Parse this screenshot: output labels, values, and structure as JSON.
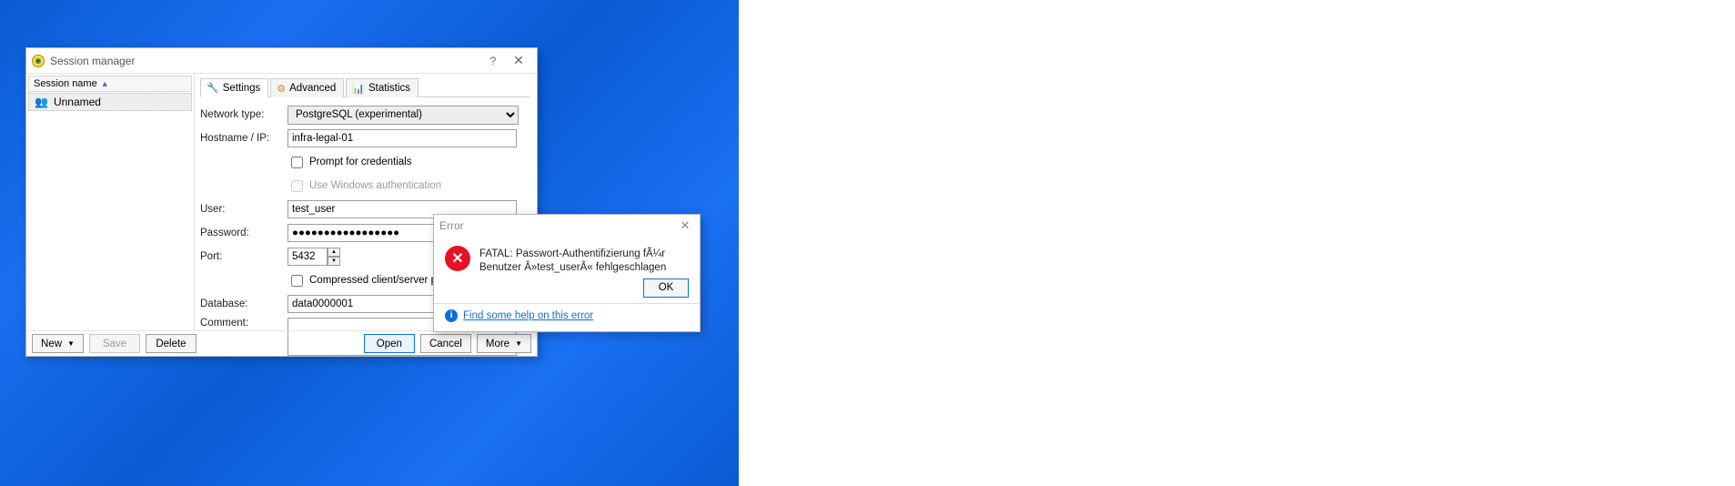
{
  "session_window": {
    "title": "Session manager",
    "session_list": {
      "header": "Session name",
      "items": [
        {
          "label": "Unnamed"
        }
      ]
    },
    "tabs": {
      "settings": "Settings",
      "advanced": "Advanced",
      "statistics": "Statistics"
    },
    "labels": {
      "network_type": "Network type:",
      "hostname": "Hostname / IP:",
      "prompt_credentials": "Prompt for credentials",
      "use_windows_auth": "Use Windows authentication",
      "user": "User:",
      "password": "Password:",
      "port": "Port:",
      "compressed": "Compressed client/server protocol",
      "database": "Database:",
      "comment": "Comment:"
    },
    "values": {
      "network_type": "PostgreSQL (experimental)",
      "hostname": "infra-legal-01",
      "user": "test_user",
      "password_mask": "●●●●●●●●●●●●●●●●●",
      "port": "5432",
      "database": "data0000001",
      "comment": ""
    },
    "buttons": {
      "new": "New",
      "save": "Save",
      "delete": "Delete",
      "open": "Open",
      "cancel": "Cancel",
      "more": "More"
    }
  },
  "error_dialog": {
    "title": "Error",
    "message": "FATAL:  Passwort-Authentifizierung fÃ¼r Benutzer Â»test_userÂ« fehlgeschlagen",
    "ok": "OK",
    "help_link": "Find some help on this error"
  }
}
